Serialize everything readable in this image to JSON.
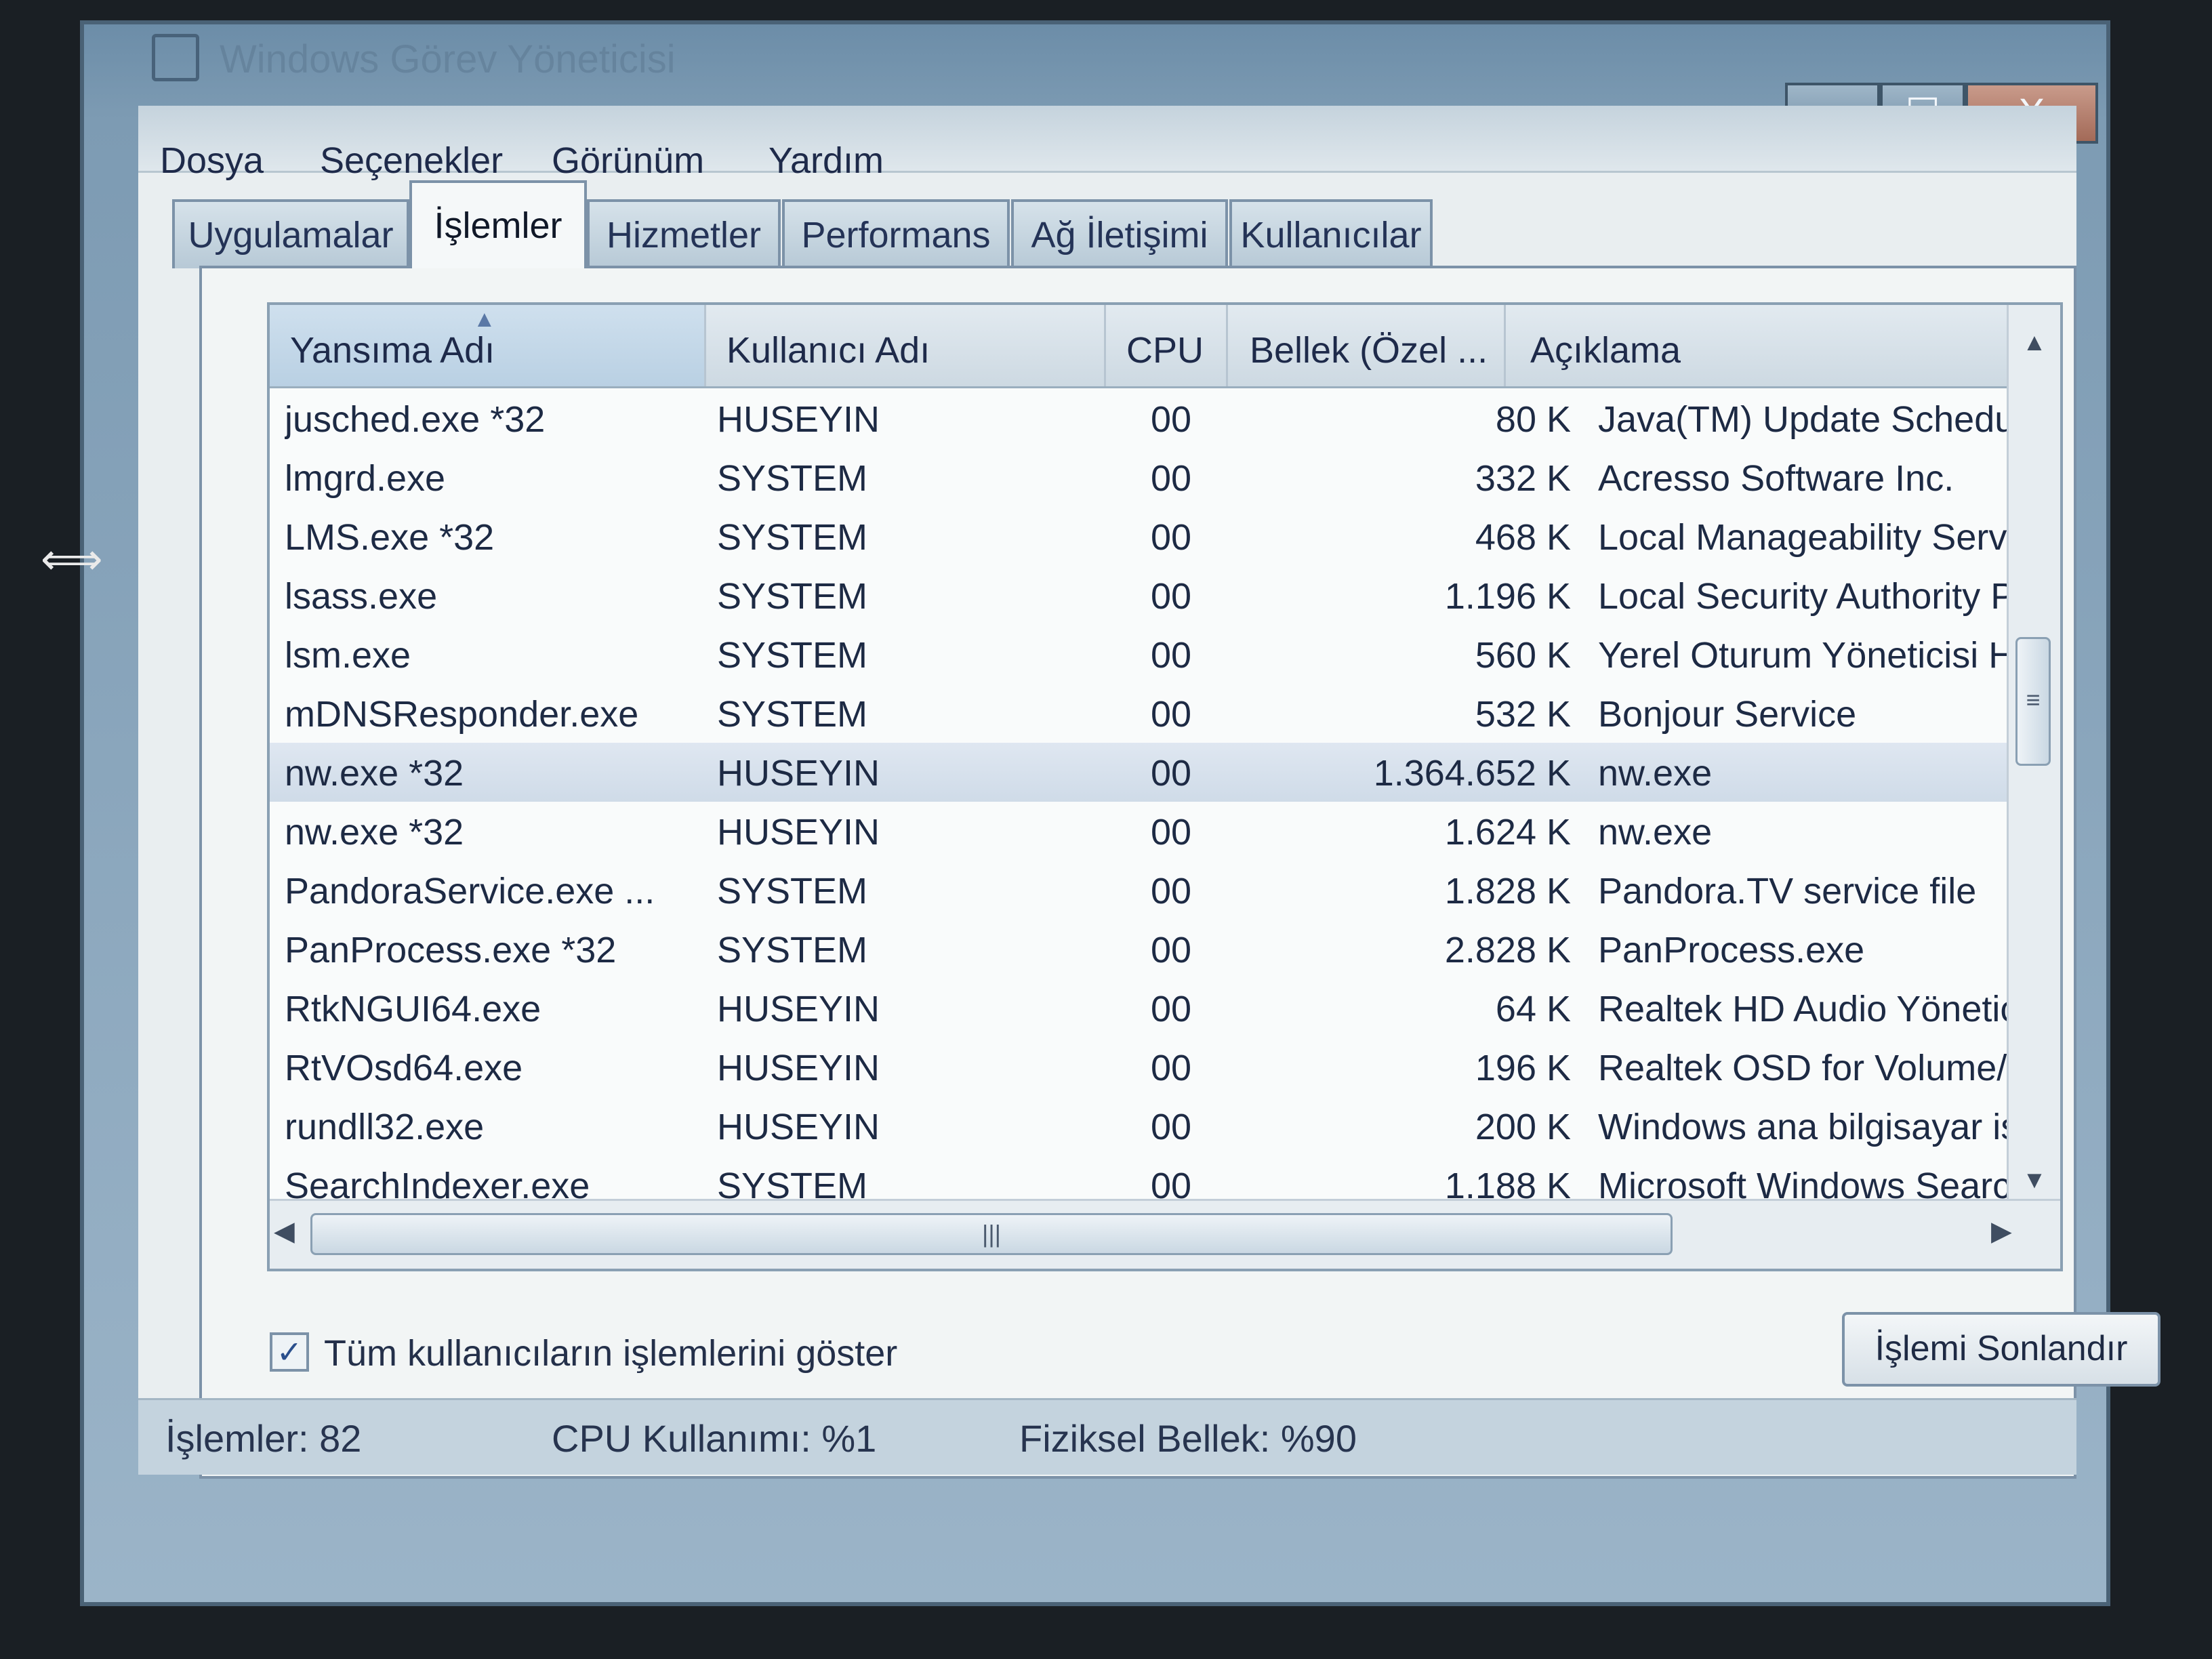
{
  "window": {
    "title": "Windows Görev Yöneticisi",
    "buttons": {
      "minimize": "–",
      "maximize": "☐",
      "close": "X"
    }
  },
  "menu": [
    "Dosya",
    "Seçenekler",
    "Görünüm",
    "Yardım"
  ],
  "tabs": [
    {
      "label": "Uygulamalar",
      "active": false
    },
    {
      "label": "İşlemler",
      "active": true
    },
    {
      "label": "Hizmetler",
      "active": false
    },
    {
      "label": "Performans",
      "active": false
    },
    {
      "label": "Ağ İletişimi",
      "active": false
    },
    {
      "label": "Kullanıcılar",
      "active": false
    }
  ],
  "table": {
    "columns": [
      "Yansıma Adı",
      "Kullanıcı Adı",
      "CPU",
      "Bellek (Özel ...",
      "Açıklama"
    ],
    "sort_indicator": "▲",
    "rows": [
      {
        "name": "jusched.exe *32",
        "user": "HUSEYIN",
        "cpu": "00",
        "memory": "80 K",
        "description": "Java(TM) Update Scheduler"
      },
      {
        "name": "lmgrd.exe",
        "user": "SYSTEM",
        "cpu": "00",
        "memory": "332 K",
        "description": "Acresso Software Inc."
      },
      {
        "name": "LMS.exe *32",
        "user": "SYSTEM",
        "cpu": "00",
        "memory": "468 K",
        "description": "Local Manageability Service"
      },
      {
        "name": "lsass.exe",
        "user": "SYSTEM",
        "cpu": "00",
        "memory": "1.196 K",
        "description": "Local Security Authority Proces"
      },
      {
        "name": "lsm.exe",
        "user": "SYSTEM",
        "cpu": "00",
        "memory": "560 K",
        "description": "Yerel Oturum Yöneticisi Hizmeti"
      },
      {
        "name": "mDNSResponder.exe",
        "user": "SYSTEM",
        "cpu": "00",
        "memory": "532 K",
        "description": "Bonjour Service"
      },
      {
        "name": "nw.exe *32",
        "user": "HUSEYIN",
        "cpu": "00",
        "memory": "1.364.652 K",
        "description": "nw.exe",
        "selected": true
      },
      {
        "name": "nw.exe *32",
        "user": "HUSEYIN",
        "cpu": "00",
        "memory": "1.624 K",
        "description": "nw.exe"
      },
      {
        "name": "PandoraService.exe ...",
        "user": "SYSTEM",
        "cpu": "00",
        "memory": "1.828 K",
        "description": "Pandora.TV service file"
      },
      {
        "name": "PanProcess.exe *32",
        "user": "SYSTEM",
        "cpu": "00",
        "memory": "2.828 K",
        "description": "PanProcess.exe"
      },
      {
        "name": "RtkNGUI64.exe",
        "user": "HUSEYIN",
        "cpu": "00",
        "memory": "64 K",
        "description": "Realtek HD Audio Yöneticisi"
      },
      {
        "name": "RtVOsd64.exe",
        "user": "HUSEYIN",
        "cpu": "00",
        "memory": "196 K",
        "description": "Realtek OSD for Volume/Mute"
      },
      {
        "name": "rundll32.exe",
        "user": "HUSEYIN",
        "cpu": "00",
        "memory": "200 K",
        "description": "Windows ana bilgisayar işlemi ("
      },
      {
        "name": "SearchIndexer.exe",
        "user": "SYSTEM",
        "cpu": "00",
        "memory": "1.188 K",
        "description": "Microsoft Windows Search Dizi"
      }
    ]
  },
  "scrollbars": {
    "up_arrow": "▲",
    "down_arrow": "▼",
    "left_arrow": "◀",
    "right_arrow": "▶",
    "grip": "|||"
  },
  "show_all_users": {
    "label": "Tüm kullanıcıların işlemlerini göster",
    "checked": true,
    "mark": "✓"
  },
  "end_process_button": "İşlemi Sonlandır",
  "status": {
    "processes": "İşlemler: 82",
    "cpu": "CPU Kullanımı: %1",
    "memory": "Fiziksel Bellek: %90"
  },
  "colors": {
    "selection": "#d4dfeb",
    "accent": "#2a4f8c"
  }
}
